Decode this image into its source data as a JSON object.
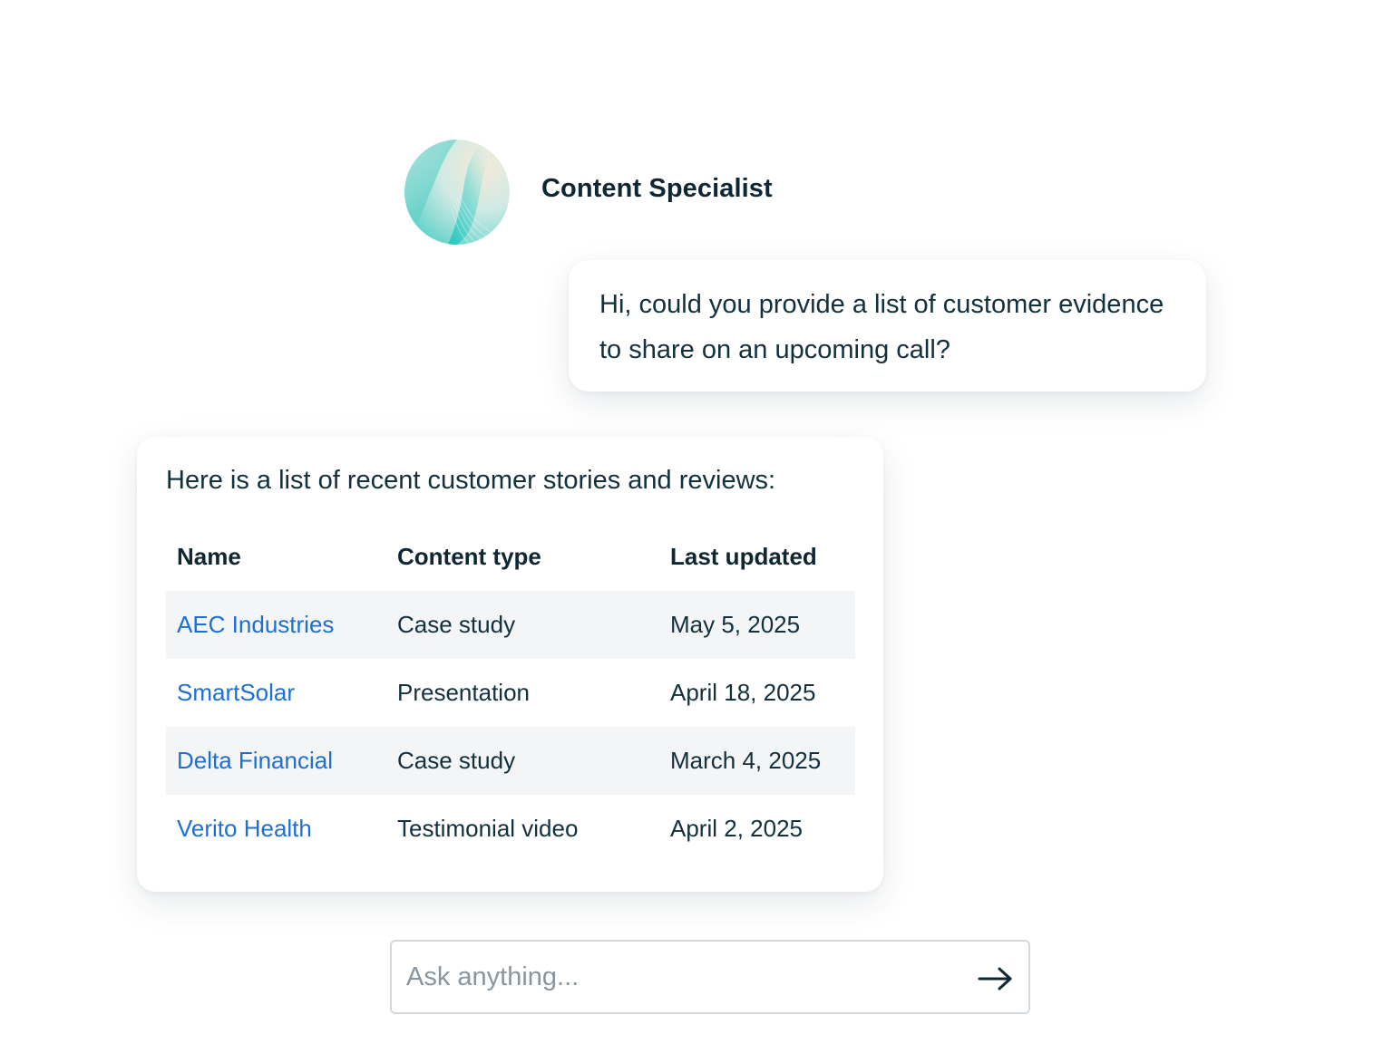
{
  "agent": {
    "name": "Content Specialist",
    "avatar_icon": "gradient-orb-avatar",
    "avatar_colors": [
      "#11c7c0",
      "#7fd9d2",
      "#dceee9",
      "#f5ead8"
    ]
  },
  "user_message": {
    "text": "Hi, could you provide a list of customer evidence to share on an upcoming call?"
  },
  "response": {
    "intro": "Here is a list of recent customer stories and reviews:",
    "table": {
      "headers": [
        "Name",
        "Content type",
        "Last updated"
      ],
      "rows": [
        {
          "name": "AEC Industries",
          "type": "Case study",
          "updated": "May 5, 2025"
        },
        {
          "name": "SmartSolar",
          "type": "Presentation",
          "updated": "April 18, 2025"
        },
        {
          "name": "Delta Financial",
          "type": "Case study",
          "updated": "March 4, 2025"
        },
        {
          "name": "Verito Health",
          "type": "Testimonial video",
          "updated": "April 2, 2025"
        }
      ]
    }
  },
  "input": {
    "placeholder": "Ask anything...",
    "value": "",
    "send_icon": "arrow-right-icon"
  },
  "colors": {
    "text": "#12303d",
    "link": "#1f6fd1",
    "row_stripe": "#f3f5f7",
    "border": "#d3d8dc"
  }
}
